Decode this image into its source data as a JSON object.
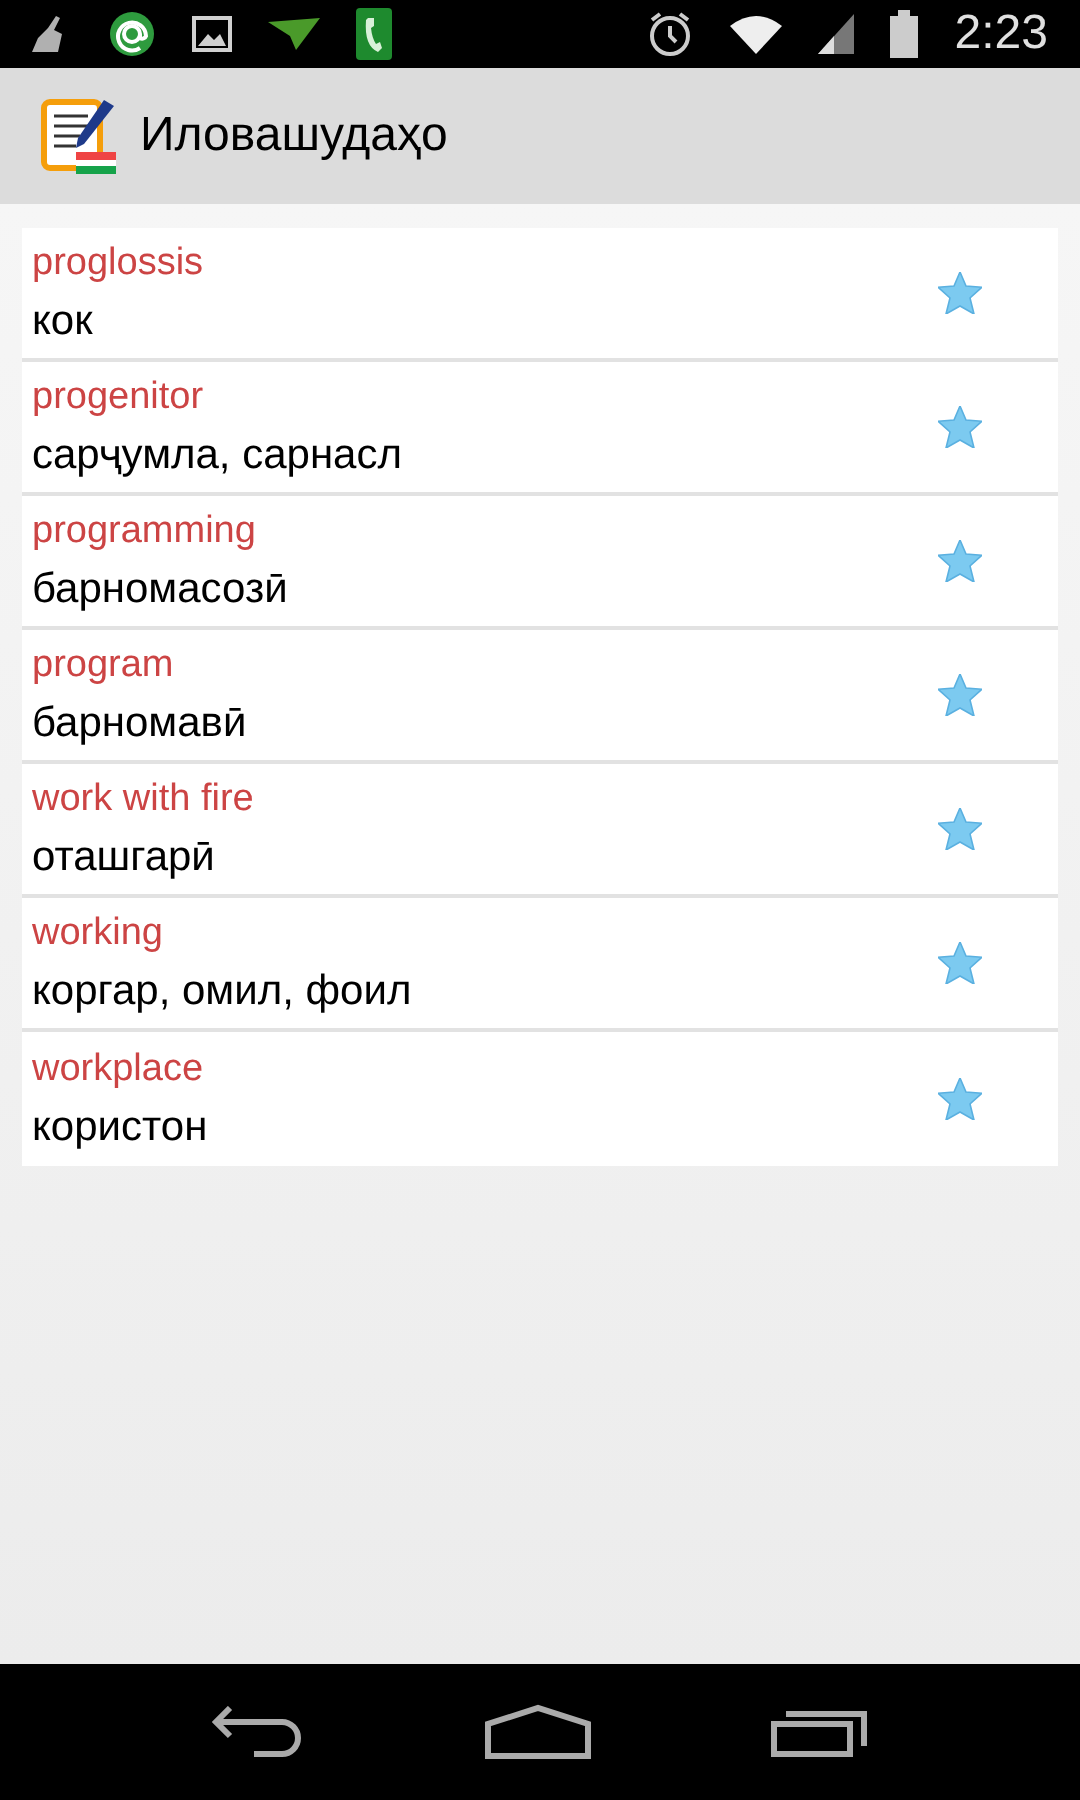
{
  "status_bar": {
    "time": "2:23"
  },
  "app_bar": {
    "title": "Иловашудаҳо"
  },
  "entries": [
    {
      "word": "proglossis",
      "translation": "кок"
    },
    {
      "word": "progenitor",
      "translation": "сарҷумла, сарнасл"
    },
    {
      "word": "programming",
      "translation": "барномасозӣ"
    },
    {
      "word": "program",
      "translation": "барномавӣ"
    },
    {
      "word": "work with fire",
      "translation": "оташгарӣ"
    },
    {
      "word": "working",
      "translation": "коргар, омил, фоил"
    },
    {
      "word": "workplace",
      "translation": "користон"
    }
  ]
}
